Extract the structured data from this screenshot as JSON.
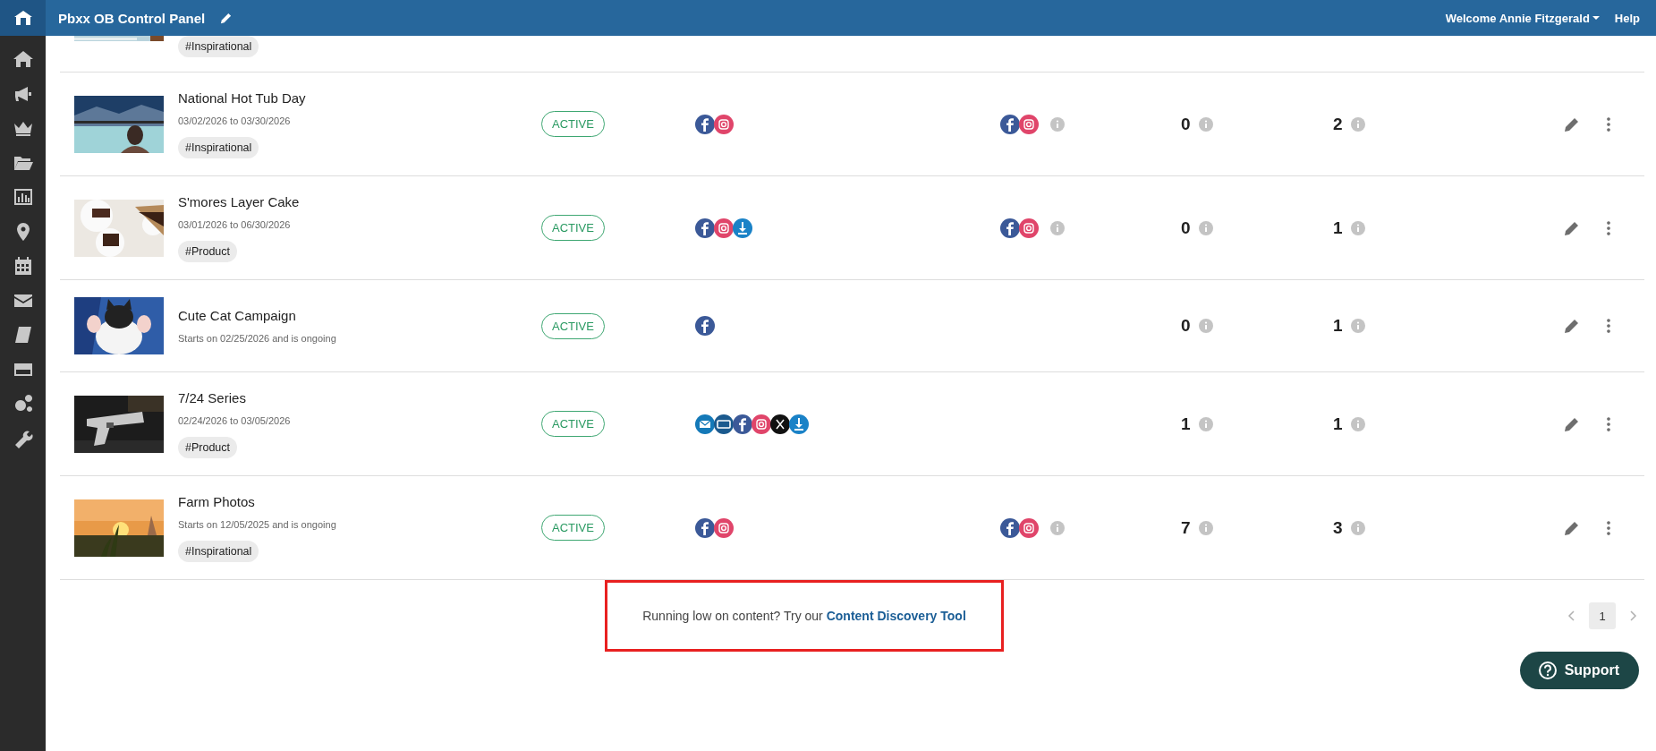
{
  "header": {
    "title": "Pbxx OB Control Panel",
    "user_menu": "Welcome Annie Fitzgerald",
    "help": "Help"
  },
  "partial_row": {
    "tag": "#Inspirational"
  },
  "campaigns": [
    {
      "title": "National Hot Tub Day",
      "dates": "03/02/2026 to 03/30/2026",
      "tag": "#Inspirational",
      "status": "ACTIVE",
      "channels": [
        {
          "kind": "facebook"
        },
        {
          "kind": "instagram"
        }
      ],
      "published_channels": [
        {
          "kind": "facebook"
        },
        {
          "kind": "instagram"
        }
      ],
      "count_1": "0",
      "count_2": "2"
    },
    {
      "title": "S'mores Layer Cake",
      "dates": "03/01/2026 to 06/30/2026",
      "tag": "#Product",
      "status": "ACTIVE",
      "channels": [
        {
          "kind": "facebook"
        },
        {
          "kind": "instagram"
        },
        {
          "kind": "download"
        }
      ],
      "published_channels": [
        {
          "kind": "facebook"
        },
        {
          "kind": "instagram"
        }
      ],
      "count_1": "0",
      "count_2": "1"
    },
    {
      "title": "Cute Cat Campaign",
      "dates": "Starts on 02/25/2026 and is ongoing",
      "status": "ACTIVE",
      "channels": [
        {
          "kind": "facebook"
        }
      ],
      "count_1": "0",
      "count_2": "1"
    },
    {
      "title": "7/24 Series",
      "dates": "02/24/2026 to 03/05/2026",
      "tag": "#Product",
      "status": "ACTIVE",
      "channels": [
        {
          "kind": "email"
        },
        {
          "kind": "message"
        },
        {
          "kind": "facebook"
        },
        {
          "kind": "instagram"
        },
        {
          "kind": "x"
        },
        {
          "kind": "download"
        }
      ],
      "count_1": "1",
      "count_2": "1"
    },
    {
      "title": "Farm Photos",
      "dates": "Starts on 12/05/2025 and is ongoing",
      "tag": "#Inspirational",
      "status": "ACTIVE",
      "channels": [
        {
          "kind": "facebook"
        },
        {
          "kind": "instagram"
        }
      ],
      "published_channels": [
        {
          "kind": "facebook"
        },
        {
          "kind": "instagram"
        }
      ],
      "count_1": "7",
      "count_2": "3"
    }
  ],
  "footer": {
    "prompt": "Running low on content? Try our",
    "link": "Content Discovery Tool"
  },
  "pagination": [
    {
      "label": "1",
      "selected": true
    }
  ],
  "support": "Support"
}
